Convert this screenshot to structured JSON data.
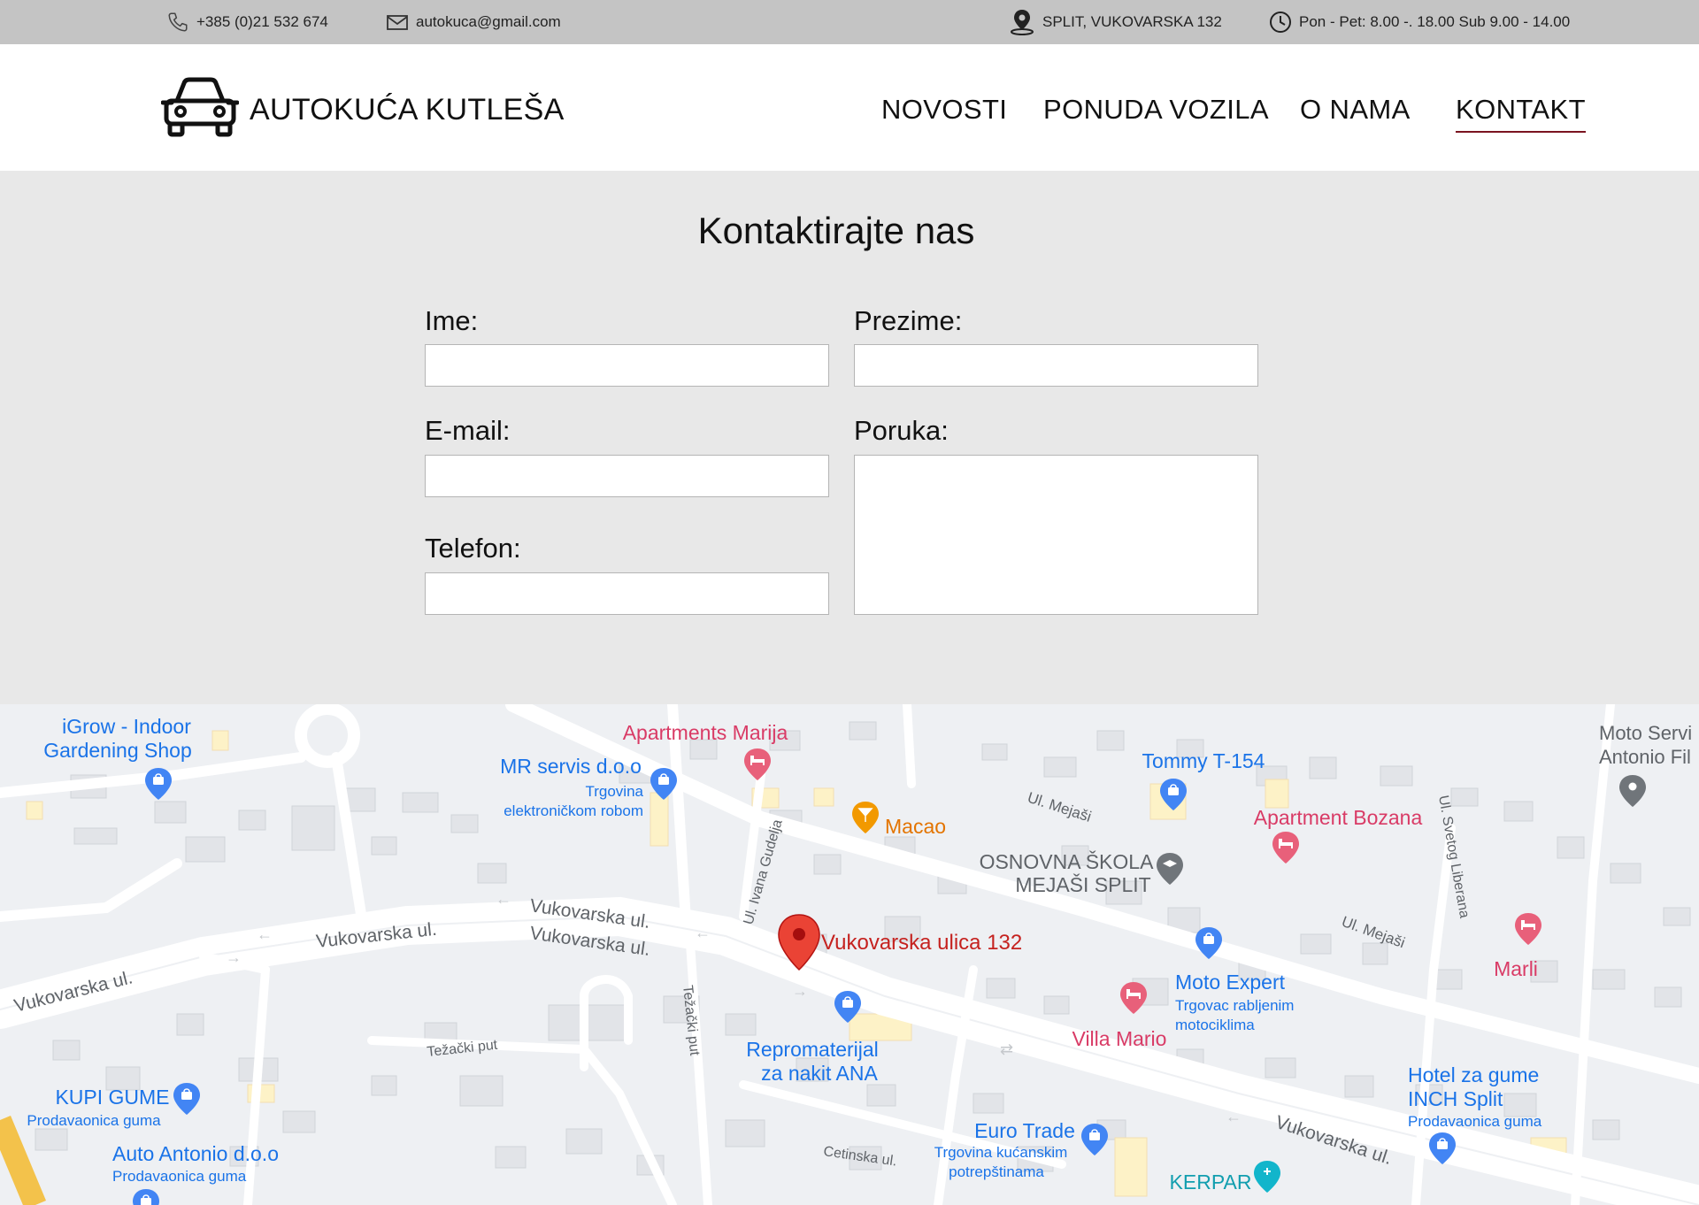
{
  "topbar": {
    "phone": "+385 (0)21 532 674",
    "email": "autokuca@gmail.com",
    "address": "SPLIT, VUKOVARSKA 132",
    "hours": "Pon - Pet: 8.00 -. 18.00 Sub 9.00 - 14.00",
    "icons": {
      "phone": "phone-icon",
      "email": "envelope-icon",
      "address": "map-pin-icon",
      "hours": "clock-icon"
    }
  },
  "header": {
    "brand": "AUTOKUĆA KUTLEŠA",
    "logo_icon": "car-icon",
    "nav": [
      {
        "label": "NOVOSTI",
        "active": false
      },
      {
        "label": "PONUDA VOZILA",
        "active": false
      },
      {
        "label": "O NAMA",
        "active": false
      },
      {
        "label": "KONTAKT",
        "active": true
      }
    ],
    "active_color": "#7a1420"
  },
  "contact": {
    "title": "Kontaktirajte nas",
    "fields": {
      "ime": {
        "label": "Ime:",
        "value": ""
      },
      "prezime": {
        "label": "Prezime:",
        "value": ""
      },
      "email": {
        "label": "E-mail:",
        "value": ""
      },
      "poruka": {
        "label": "Poruka:",
        "value": ""
      },
      "telefon": {
        "label": "Telefon:",
        "value": ""
      }
    }
  },
  "map": {
    "marker_label": "Vukovarska ulica 132",
    "streets": [
      "Vukovarska ul.",
      "Vukovarska ul.",
      "Vukovarska ul.",
      "Vukovarska ul.",
      "Vukovarska ul.",
      "Ul. Mejaši",
      "Ul. Mejaši",
      "Ul. Ivana Gudelja",
      "Težački put",
      "Težački put",
      "Ul. Svetog Liberana",
      "Cetinska ul."
    ],
    "places": {
      "igrow_1": "iGrow - Indoor",
      "igrow_2": "Gardening Shop",
      "mr_servis": "MR servis d.o.o",
      "mr_sub1": "Trgovina",
      "mr_sub2": "elektroničkom robom",
      "apartments_marija": "Apartments Marija",
      "macao": "Macao",
      "tommy": "Tommy T-154",
      "apartment_bozana": "Apartment Bozana",
      "moto_servis_1": "Moto Servi",
      "moto_servis_2": "Antonio Fil",
      "osnovna_1": "OSNOVNA ŠKOLA",
      "osnovna_2": "MEJAŠI SPLIT",
      "marli": "Marli",
      "moto_expert": "Moto Expert",
      "moto_expert_sub1": "Trgovac rabljenim",
      "moto_expert_sub2": "motociklima",
      "villa_mario": "Villa Mario",
      "repro_1": "Repromaterijal",
      "repro_2": "za nakit ANA",
      "kupi_gume": "KUPI GUME",
      "kupi_sub": "Prodavaonica guma",
      "auto_antonio": "Auto Antonio d.o.o",
      "auto_antonio_sub": "Prodavaonica guma",
      "hotel_gume_1": "Hotel za gume",
      "hotel_gume_2": "INCH Split",
      "hotel_sub": "Prodavaonica guma",
      "euro_trade": "Euro Trade",
      "euro_sub1": "Trgovina kućanskim",
      "euro_sub2": "potrepštinama",
      "kerpar": "KERPAR"
    },
    "colors": {
      "marker": "#ea4335",
      "shop_pin": "#4285f4",
      "lodging_pin": "#e8607a",
      "bar_pin": "#f29900",
      "school_pin": "#70757a",
      "health_pin": "#12b5cb"
    }
  }
}
